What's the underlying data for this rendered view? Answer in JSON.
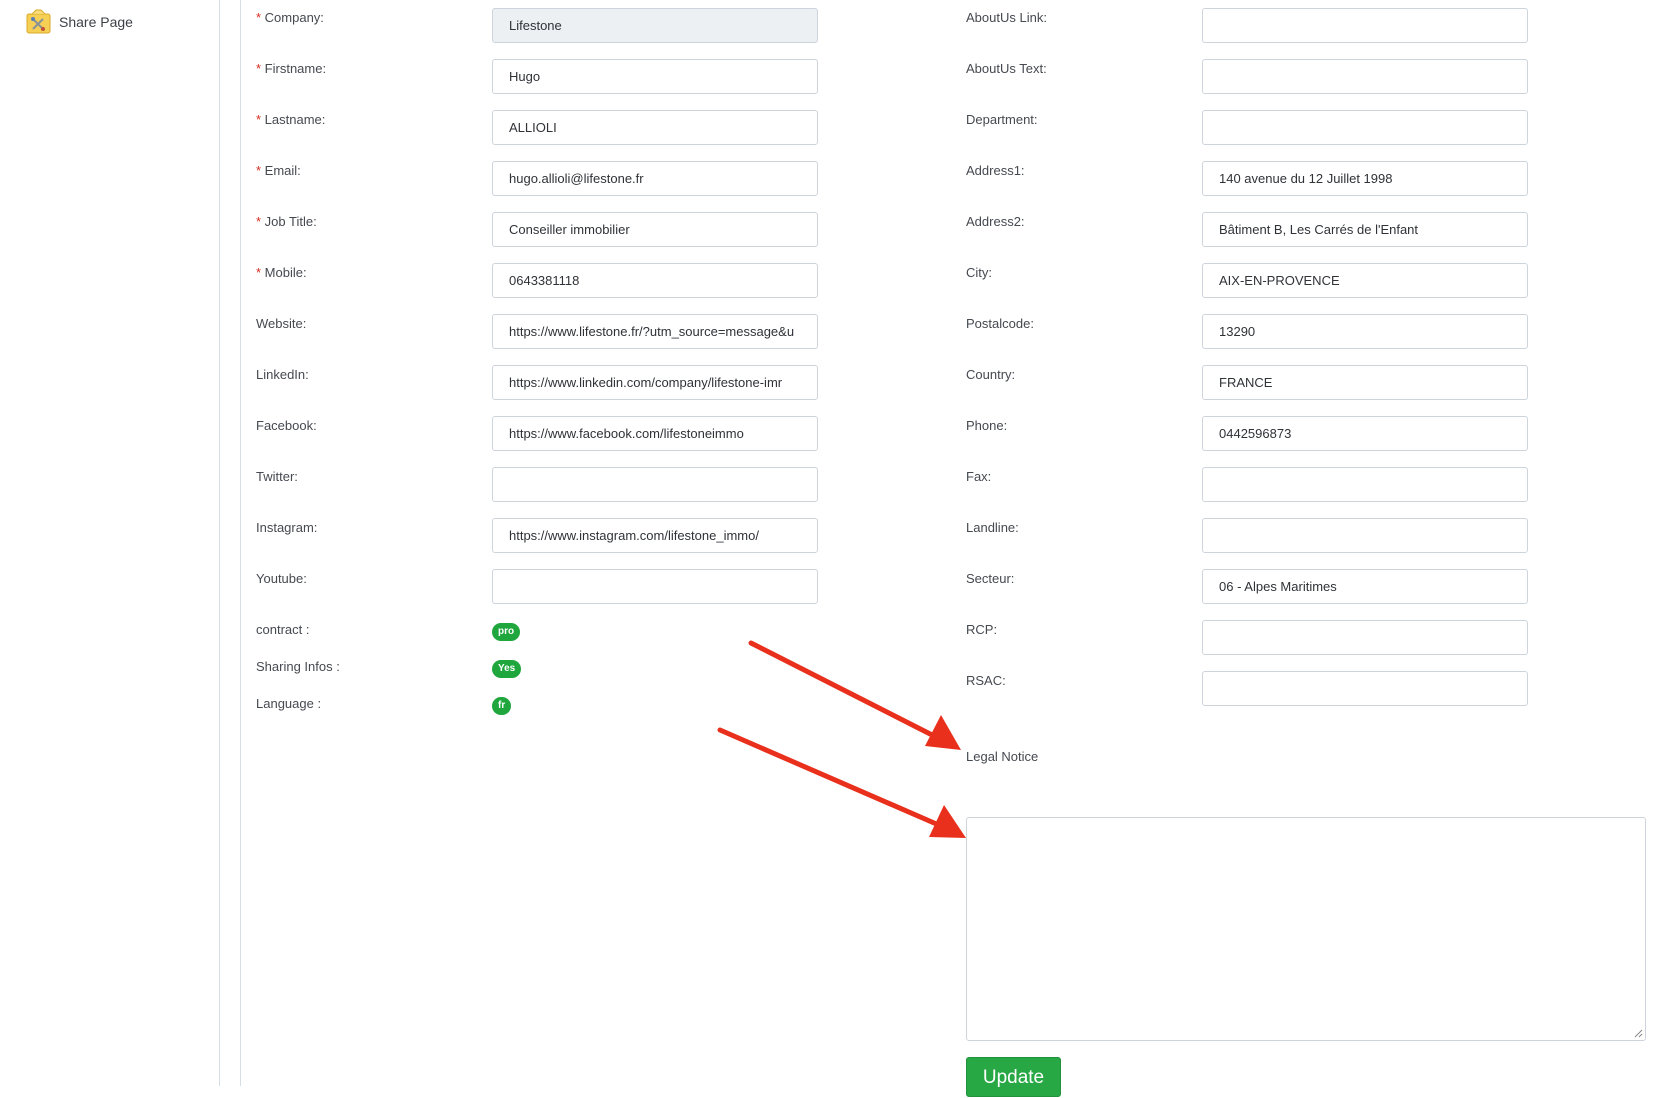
{
  "sidebar": {
    "share_label": "Share Page",
    "share_icon": "share-page-icon"
  },
  "left_fields": [
    {
      "label": "Company:",
      "required": true,
      "value": "Lifestone",
      "disabled": true
    },
    {
      "label": "Firstname:",
      "required": true,
      "value": "Hugo"
    },
    {
      "label": "Lastname:",
      "required": true,
      "value": "ALLIOLI"
    },
    {
      "label": "Email:",
      "required": true,
      "value": "hugo.allioli@lifestone.fr"
    },
    {
      "label": "Job Title:",
      "required": true,
      "value": "Conseiller immobilier"
    },
    {
      "label": "Mobile:",
      "required": true,
      "value": "0643381118"
    },
    {
      "label": "Website:",
      "value": "https://www.lifestone.fr/?utm_source=message&u"
    },
    {
      "label": "LinkedIn:",
      "value": "https://www.linkedin.com/company/lifestone-imr"
    },
    {
      "label": "Facebook:",
      "value": "https://www.facebook.com/lifestoneimmo"
    },
    {
      "label": "Twitter:",
      "value": ""
    },
    {
      "label": "Instagram:",
      "value": "https://www.instagram.com/lifestone_immo/"
    },
    {
      "label": "Youtube:",
      "value": ""
    }
  ],
  "badges": [
    {
      "label": "contract :",
      "value": "pro"
    },
    {
      "label": "Sharing Infos :",
      "value": "Yes"
    },
    {
      "label": "Language :",
      "value": "fr"
    }
  ],
  "right_fields": [
    {
      "label": "AboutUs Link:",
      "value": ""
    },
    {
      "label": "AboutUs Text:",
      "value": ""
    },
    {
      "label": "Department:",
      "value": ""
    },
    {
      "label": "Address1:",
      "value": "140 avenue du 12 Juillet 1998"
    },
    {
      "label": "Address2:",
      "value": "Bâtiment B, Les Carrés de l'Enfant"
    },
    {
      "label": "City:",
      "value": "AIX-EN-PROVENCE"
    },
    {
      "label": "Postalcode:",
      "value": "13290"
    },
    {
      "label": "Country:",
      "value": "FRANCE"
    },
    {
      "label": "Phone:",
      "value": "0442596873"
    },
    {
      "label": "Fax:",
      "value": ""
    },
    {
      "label": "Landline:",
      "value": ""
    },
    {
      "label": "Secteur:",
      "value": "06 - Alpes Maritimes"
    },
    {
      "label": "RCP:",
      "value": ""
    },
    {
      "label": "RSAC:",
      "value": ""
    }
  ],
  "legal_notice": {
    "label": "Legal Notice",
    "value": ""
  },
  "update_label": "Update",
  "colors": {
    "badge": "#1fa63d",
    "button": "#28a745",
    "arrow": "#e8301c",
    "required": "#d62d20"
  }
}
